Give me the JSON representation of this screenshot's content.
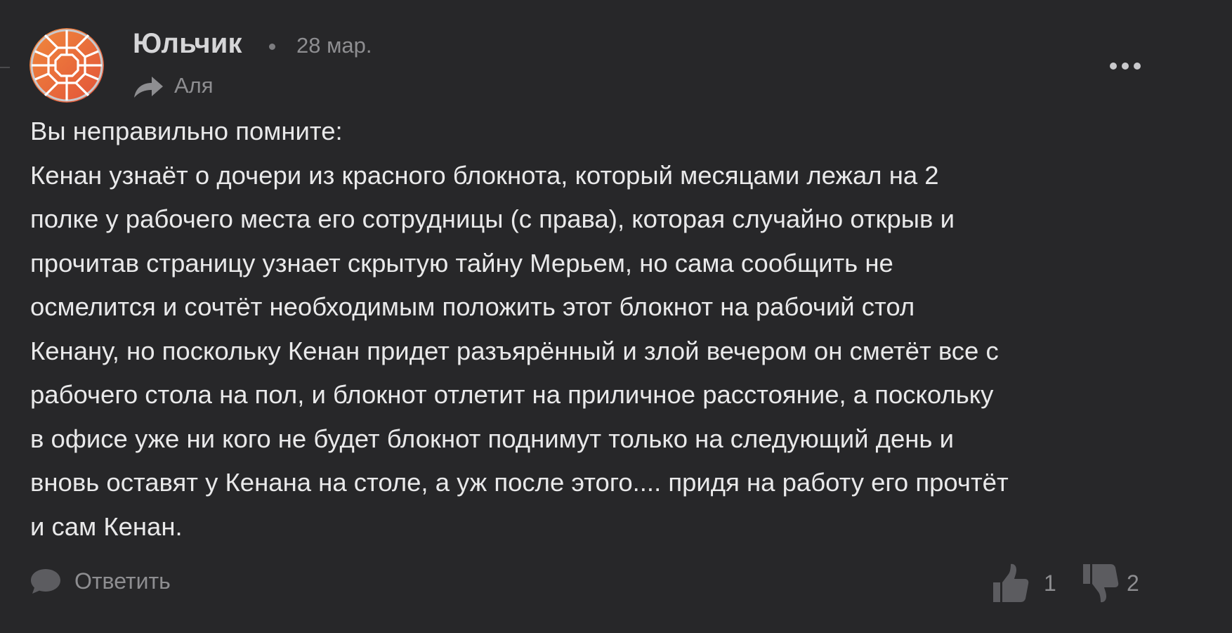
{
  "comment": {
    "author": "Юльчик",
    "date": "28 мар.",
    "reply_to": "Аля",
    "text_lines": [
      "Вы неправильно помните:",
      "Кенан узнаёт о дочери из красного блокнота, который месяцами лежал на 2",
      "полке у рабочего места его сотрудницы (с права), которая случайно открыв и",
      "прочитав страницу узнает скрытую тайну Мерьем, но сама сообщить не",
      "осмелится и сочтёт необходимым положить этот блокнот на рабочий стол",
      "Кенану, но поскольку Кенан придет разъярённый и злой вечером он сметёт все с",
      "рабочего стола на пол, и блокнот отлетит на приличное расстояние, а поскольку",
      "в офисе уже ни кого не будет блокнот поднимут только на следующий день и",
      "вновь оставят у Кенана на столе, а уж после этого.... придя на работу его прочтёт",
      "и сам Кенан."
    ]
  },
  "actions": {
    "reply_label": "Ответить",
    "likes": "1",
    "dislikes": "2"
  },
  "icons": {
    "avatar": "geometric-orange-avatar",
    "reply_to": "share-arrow-icon",
    "more": "more-dots-icon",
    "reply": "speech-bubble-icon",
    "like": "thumbs-up-icon",
    "dislike": "thumbs-down-icon"
  },
  "colors": {
    "background": "#272729",
    "text": "#e9e9ea",
    "muted": "#8e8e91",
    "avatar_orange": "#e8673a"
  }
}
